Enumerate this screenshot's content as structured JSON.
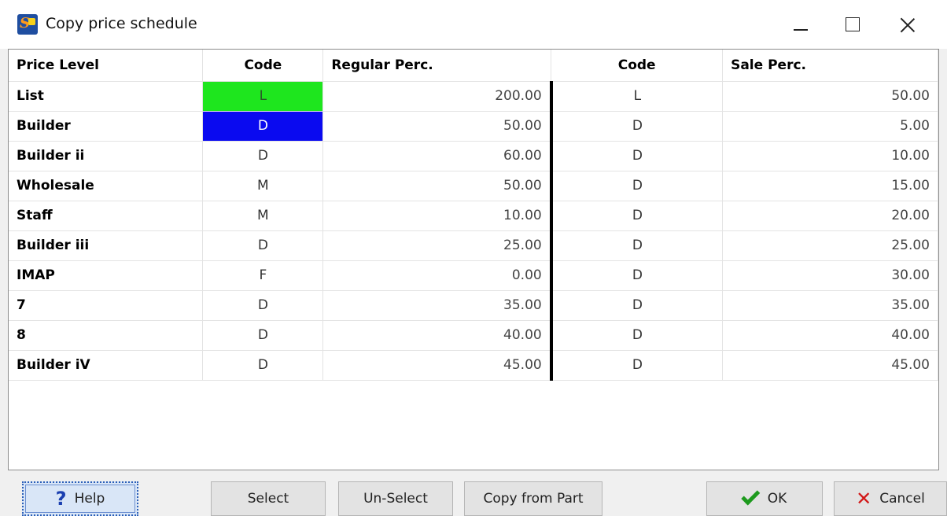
{
  "window": {
    "title": "Copy price schedule"
  },
  "grid": {
    "headers": [
      "Price Level",
      "Code",
      "Regular Perc.",
      "Code",
      "Sale Perc."
    ],
    "rows": [
      {
        "level": "List",
        "code": "L",
        "regular": "200.00",
        "sale_code": "L",
        "sale": "50.00"
      },
      {
        "level": "Builder",
        "code": "D",
        "regular": "50.00",
        "sale_code": "D",
        "sale": "5.00"
      },
      {
        "level": "Builder ii",
        "code": "D",
        "regular": "60.00",
        "sale_code": "D",
        "sale": "10.00"
      },
      {
        "level": "Wholesale",
        "code": "M",
        "regular": "50.00",
        "sale_code": "D",
        "sale": "15.00"
      },
      {
        "level": "Staff",
        "code": "M",
        "regular": "10.00",
        "sale_code": "D",
        "sale": "20.00"
      },
      {
        "level": "Builder iii",
        "code": "D",
        "regular": "25.00",
        "sale_code": "D",
        "sale": "25.00"
      },
      {
        "level": "IMAP",
        "code": "F",
        "regular": "0.00",
        "sale_code": "D",
        "sale": "30.00"
      },
      {
        "level": "7",
        "code": "D",
        "regular": "35.00",
        "sale_code": "D",
        "sale": "35.00"
      },
      {
        "level": "8",
        "code": "D",
        "regular": "40.00",
        "sale_code": "D",
        "sale": "40.00"
      },
      {
        "level": "Builder iV",
        "code": "D",
        "regular": "45.00",
        "sale_code": "D",
        "sale": "45.00"
      }
    ],
    "highlight_colors": {
      "list_code": "#1ee61e",
      "builder_code": "#0a0af0"
    }
  },
  "buttons": {
    "help": "Help",
    "select": "Select",
    "unselect": "Un-Select",
    "copy_from_part": "Copy from Part",
    "ok": "OK",
    "cancel": "Cancel"
  },
  "icons": {
    "app": "app-logo-icon",
    "help": "question-mark-icon",
    "ok": "checkmark-icon",
    "cancel": "red-x-icon"
  }
}
